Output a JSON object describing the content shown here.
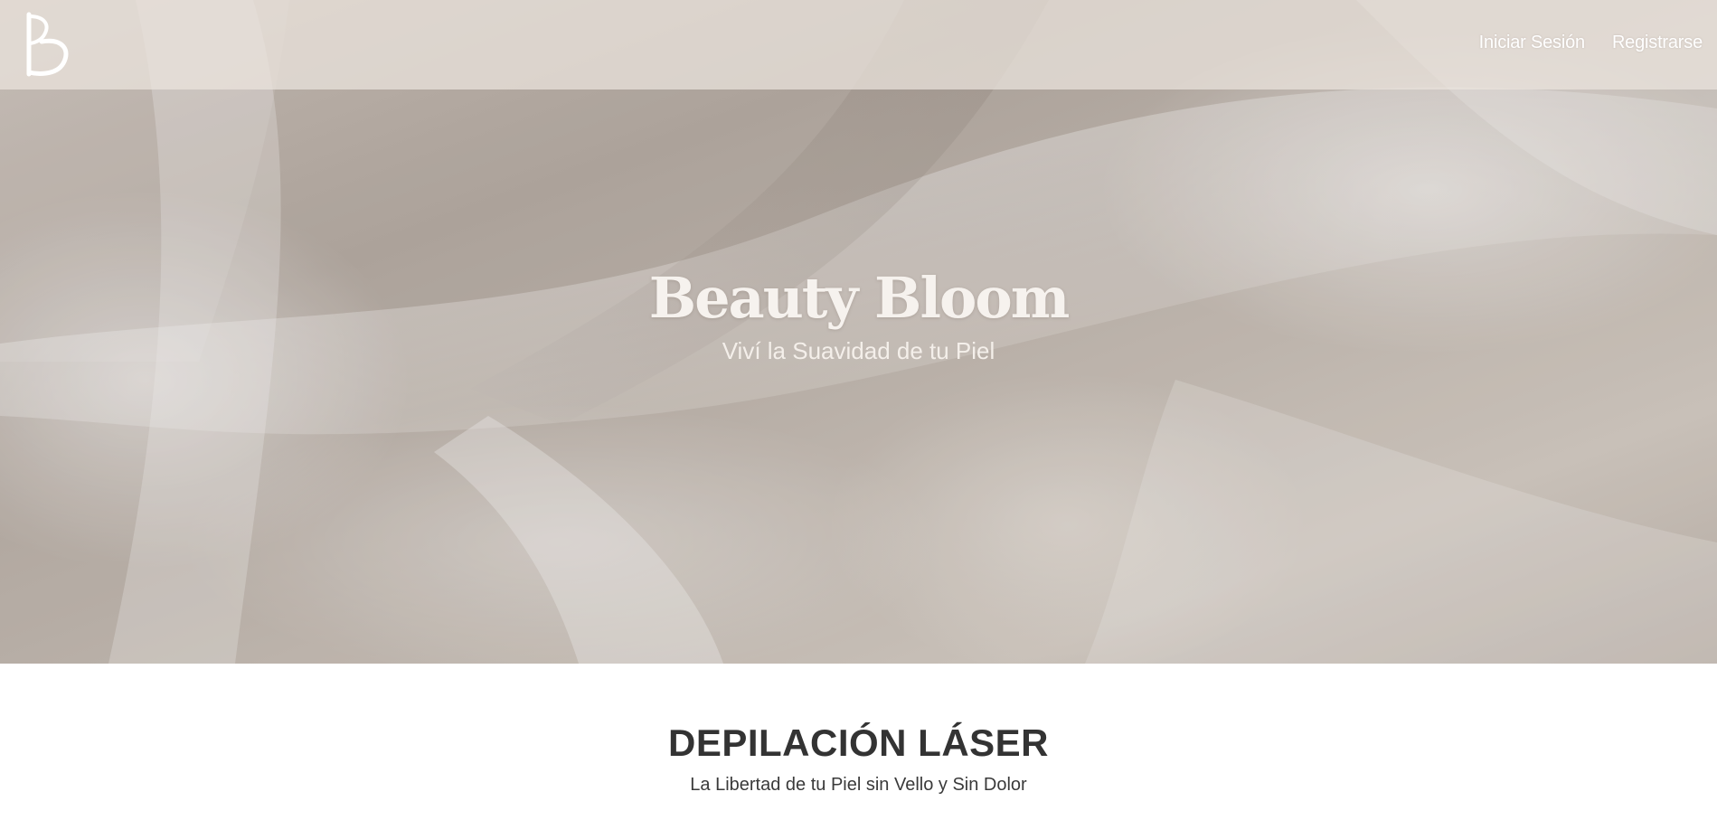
{
  "header": {
    "logo_icon": "beauty-bloom-monogram-icon",
    "nav": {
      "login_label": "Iniciar Sesión",
      "register_label": "Registrarse"
    }
  },
  "hero": {
    "title": "Beauty Bloom",
    "subtitle": "Viví la Suavidad de tu Piel",
    "background": "silk-fabric-image"
  },
  "section": {
    "title": "DEPILACIÓN LÁSER",
    "subtitle": "La Libertad de tu Piel sin Vello y Sin Dolor"
  },
  "colors": {
    "header_bg": "#ece4de",
    "hero_tone": "#bdb4ac",
    "text_light": "#f6f2ee",
    "text_dark": "#333333"
  }
}
